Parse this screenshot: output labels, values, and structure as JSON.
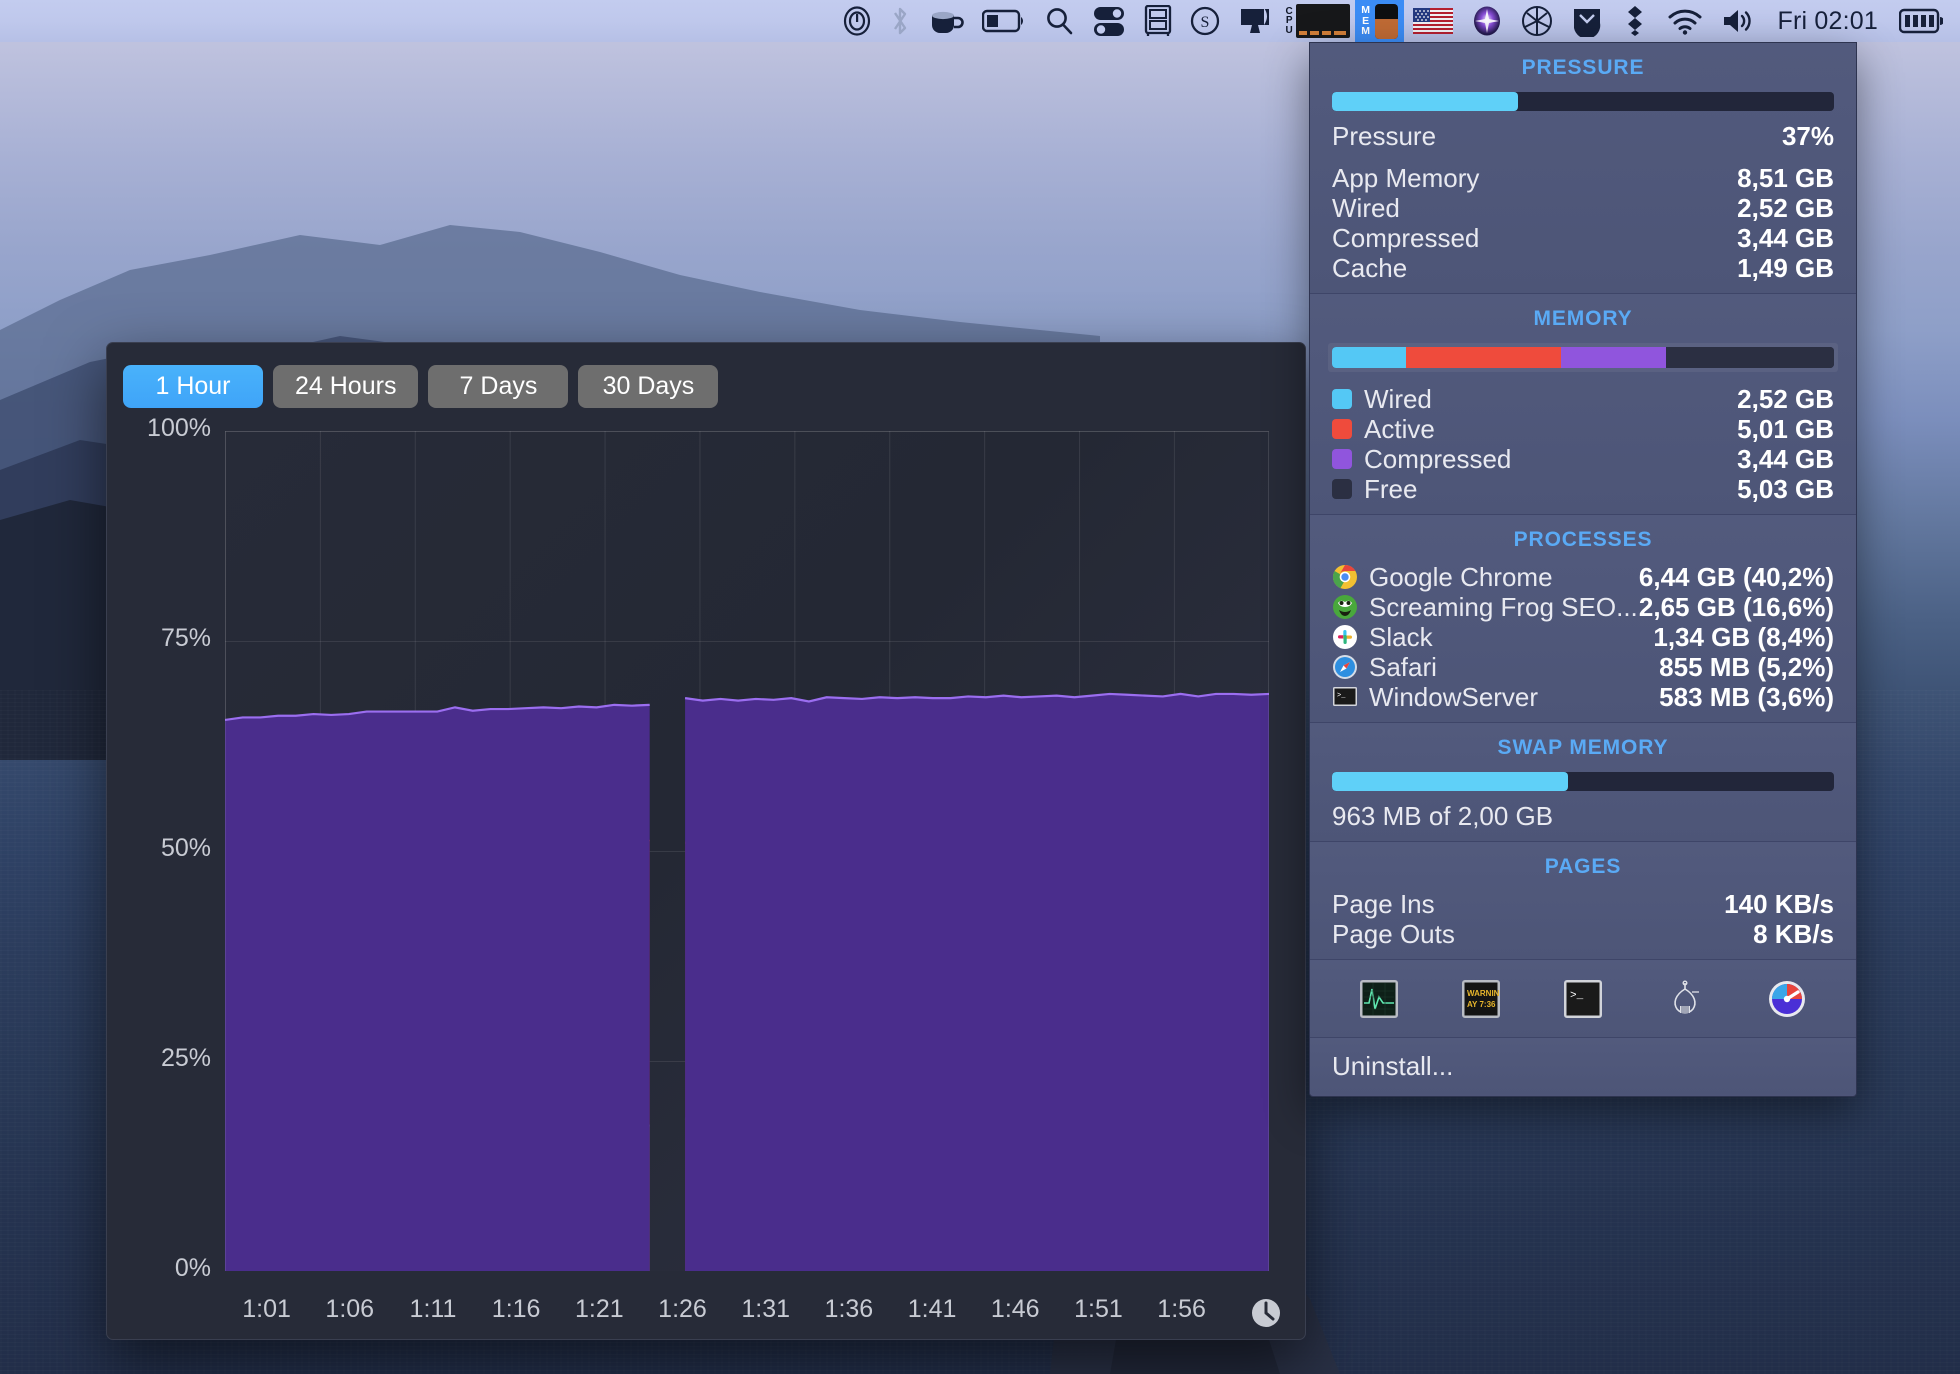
{
  "menubar": {
    "icons": [
      {
        "name": "onepassword-icon"
      },
      {
        "name": "bluetooth-icon"
      },
      {
        "name": "coffee-cup-icon"
      },
      {
        "name": "battery-icon"
      },
      {
        "name": "spotlight-search-icon"
      },
      {
        "name": "toggles-icon"
      },
      {
        "name": "archive-drawer-icon"
      },
      {
        "name": "s-circle-icon"
      },
      {
        "name": "display-icon"
      }
    ],
    "cpu_label": "CPU",
    "mem_label": "MEM",
    "right_icons": [
      {
        "name": "us-flag-icon"
      },
      {
        "name": "siri-icon"
      },
      {
        "name": "aperture-icon"
      },
      {
        "name": "pocket-icon"
      },
      {
        "name": "dropbox-icon"
      },
      {
        "name": "wifi-icon"
      },
      {
        "name": "volume-icon"
      }
    ],
    "clock": "Fri 02:01",
    "battery_icon": "battery-full-icon"
  },
  "graph_window": {
    "ranges": [
      {
        "label": "1 Hour",
        "active": true
      },
      {
        "label": "24 Hours",
        "active": false
      },
      {
        "label": "7 Days",
        "active": false
      },
      {
        "label": "30 Days",
        "active": false
      }
    ],
    "clock_icon": "clock-icon"
  },
  "chart_data": {
    "type": "area",
    "title": "Memory usage over last hour",
    "stacked": true,
    "xlabel": "",
    "ylabel": "",
    "ylim": [
      0,
      100
    ],
    "ytick_labels": [
      "0%",
      "25%",
      "50%",
      "75%",
      "100%"
    ],
    "ytick_values": [
      0,
      25,
      50,
      75,
      100
    ],
    "grid": true,
    "x_tick_labels": [
      "1:01",
      "1:06",
      "1:11",
      "1:16",
      "1:21",
      "1:26",
      "1:31",
      "1:36",
      "1:41",
      "1:46",
      "1:51",
      "1:56"
    ],
    "gap_region": {
      "from_minute": "1:25",
      "to_minute": "1:27",
      "note": "data gap"
    },
    "series": [
      {
        "name": "Wired",
        "color": "#2d7ca6",
        "line_color": "#54c4f0",
        "values": [
          17.2,
          17.3,
          17.1,
          17.4,
          17.2,
          17.3,
          17.1,
          17.2,
          17.4,
          17.3,
          17.2,
          17.1,
          17.3,
          17.4,
          17.2,
          17.3,
          17.2,
          17.1,
          17.3,
          17.2,
          17.4,
          17.3,
          17.2,
          17.5,
          17.3,
          19.5,
          18.2,
          17.9,
          17.8,
          17.6,
          17.7,
          17.5,
          17.6,
          17.4,
          17.5,
          17.6,
          17.4,
          17.5,
          17.6,
          17.4,
          17.5,
          17.4,
          17.6,
          17.5,
          17.4,
          17.5,
          17.6,
          17.4,
          17.5,
          17.4,
          17.6,
          17.5,
          17.4,
          17.3,
          17.5,
          17.4,
          17.6,
          17.5,
          17.4,
          17.5
        ]
      },
      {
        "name": "Active",
        "color": "#a32420",
        "line_color": "#ef3b32",
        "values": [
          34.4,
          34.5,
          34.6,
          34.4,
          34.5,
          34.7,
          34.6,
          34.5,
          34.7,
          34.6,
          34.8,
          34.7,
          34.6,
          34.8,
          34.7,
          34.6,
          34.8,
          34.9,
          34.7,
          34.8,
          34.6,
          34.7,
          34.9,
          34.2,
          33.9,
          31.5,
          32.8,
          32.9,
          33.0,
          33.1,
          33.0,
          33.2,
          33.1,
          33.0,
          33.2,
          33.1,
          33.3,
          33.2,
          33.1,
          33.3,
          33.2,
          33.4,
          33.2,
          33.3,
          33.4,
          33.2,
          33.3,
          33.4,
          33.2,
          33.3,
          33.4,
          33.2,
          33.3,
          33.4,
          33.3,
          33.2,
          33.1,
          33.3,
          33.4,
          33.2
        ]
      },
      {
        "name": "Compressed",
        "color": "#4a2d8c",
        "line_color": "#9b6ef0",
        "values": [
          14.0,
          14.1,
          14.2,
          14.3,
          14.4,
          14.3,
          14.5,
          14.6,
          14.5,
          14.7,
          14.6,
          14.8,
          14.7,
          14.9,
          14.8,
          15.0,
          14.9,
          15.0,
          15.1,
          15.0,
          15.2,
          15.1,
          15.3,
          15.6,
          16.2,
          18.6,
          17.2,
          17.1,
          17.3,
          17.2,
          17.4,
          17.3,
          17.5,
          17.4,
          17.6,
          17.5,
          17.4,
          17.6,
          17.5,
          17.6,
          17.5,
          17.4,
          17.6,
          17.5,
          17.7,
          17.6,
          17.5,
          17.7,
          17.6,
          17.8,
          17.7,
          17.9,
          17.8,
          17.7,
          17.9,
          17.8,
          18.0,
          17.9,
          17.8,
          18.0
        ]
      }
    ]
  },
  "panel": {
    "pressure": {
      "title": "PRESSURE",
      "bar_percent": 37,
      "bar_color": "#5fd0f8",
      "rows": [
        {
          "label": "Pressure",
          "value": "37%"
        },
        {
          "label": "App Memory",
          "value": "8,51 GB"
        },
        {
          "label": "Wired",
          "value": "2,52 GB"
        },
        {
          "label": "Compressed",
          "value": "3,44 GB"
        },
        {
          "label": "Cache",
          "value": "1,49 GB"
        }
      ]
    },
    "memory": {
      "title": "MEMORY",
      "segments": [
        {
          "label": "Wired",
          "value": "2,52 GB",
          "color": "#54c8f5",
          "percent": 14.8
        },
        {
          "label": "Active",
          "value": "5,01 GB",
          "color": "#ef4b3c",
          "percent": 30.8
        },
        {
          "label": "Compressed",
          "value": "3,44 GB",
          "color": "#9055dd",
          "percent": 21.0
        },
        {
          "label": "Free",
          "value": "5,03 GB",
          "color": "#2b2f42",
          "percent": 33.4
        }
      ]
    },
    "processes": {
      "title": "PROCESSES",
      "rows": [
        {
          "icon": "chrome-icon",
          "name": "Google Chrome",
          "value": "6,44 GB (40,2%)"
        },
        {
          "icon": "screaming-frog-icon",
          "name": "Screaming Frog SEO...",
          "value": "2,65 GB (16,6%)"
        },
        {
          "icon": "slack-icon",
          "name": "Slack",
          "value": "1,34 GB (8,4%)"
        },
        {
          "icon": "safari-icon",
          "name": "Safari",
          "value": "855 MB (5,2%)"
        },
        {
          "icon": "terminal-icon",
          "name": "WindowServer",
          "value": "583 MB (3,6%)"
        }
      ]
    },
    "swap": {
      "title": "SWAP MEMORY",
      "bar_percent": 47,
      "bar_color": "#5fd0f8",
      "text": "963 MB of 2,00 GB"
    },
    "pages": {
      "title": "PAGES",
      "rows": [
        {
          "label": "Page Ins",
          "value": "140 KB/s"
        },
        {
          "label": "Page Outs",
          "value": "8 KB/s"
        }
      ]
    },
    "tools": [
      {
        "name": "activity-monitor-icon"
      },
      {
        "name": "console-warning-icon"
      },
      {
        "name": "terminal-app-icon"
      },
      {
        "name": "memory-clean-icon"
      },
      {
        "name": "istat-menus-icon"
      }
    ],
    "uninstall_label": "Uninstall..."
  }
}
